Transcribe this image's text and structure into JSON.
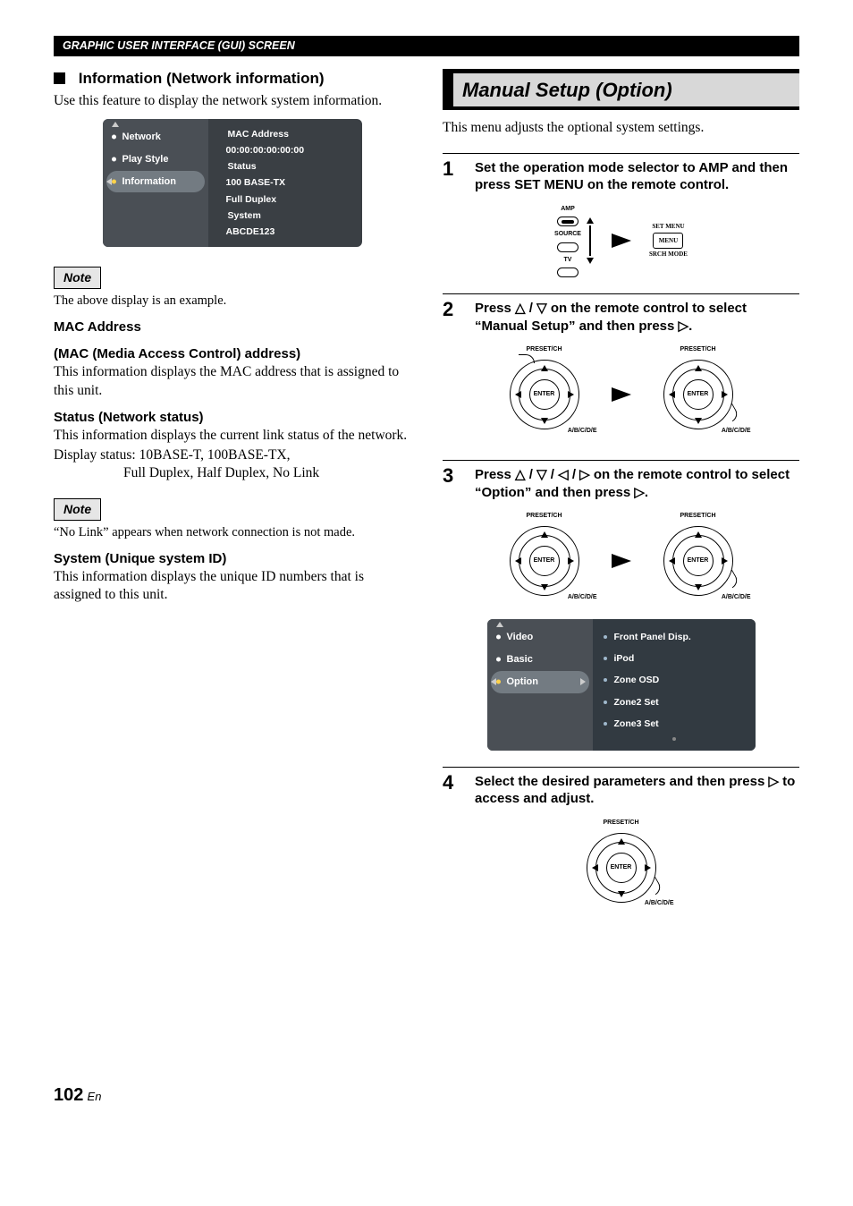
{
  "header": "GRAPHIC USER INTERFACE (GUI) SCREEN",
  "left": {
    "title": "Information (Network information)",
    "intro": "Use this feature to display the network system information.",
    "osd": {
      "items": [
        "Network",
        "Play Style",
        "Information"
      ],
      "right": {
        "mac_label": "MAC Address",
        "mac_value": "00:00:00:00:00:00",
        "status_label": "Status",
        "status_v1": "100 BASE-TX",
        "status_v2": "Full Duplex",
        "system_label": "System",
        "system_value": "ABCDE123"
      }
    },
    "note1_label": "Note",
    "note1_text": "The above display is an example.",
    "mac_head": "MAC Address",
    "mac_sub": "(MAC (Media Access Control) address)",
    "mac_body": "This information displays the MAC address that is assigned to this unit.",
    "status_head": "Status (Network status)",
    "status_body": "This information displays the current link status of the network.",
    "status_line1": "Display status: 10BASE-T, 100BASE-TX,",
    "status_line2": "Full Duplex, Half Duplex, No Link",
    "note2_label": "Note",
    "note2_text": "“No Link” appears when network connection is not made.",
    "system_head": "System (Unique system ID)",
    "system_body": "This information displays the unique ID numbers that is assigned to this unit."
  },
  "right": {
    "title": "Manual Setup (Option)",
    "intro": "This menu adjusts the optional system settings.",
    "steps": {
      "s1": "Set the operation mode selector to AMP and then press SET MENU on the remote control.",
      "s2a": "Press ",
      "s2b": " on the remote control to select “Manual Setup” and then press ",
      "s3a": "Press ",
      "s3b": " on the remote control to select “Option” and then press ",
      "s4a": "Select the desired parameters and then press ",
      "s4b": " to access and adjust."
    },
    "selector": {
      "amp": "AMP",
      "source": "SOURCE",
      "tv": "TV",
      "setmenu": "SET MENU",
      "menu": "MENU",
      "srch": "SRCH MODE"
    },
    "dpad": {
      "top": "PRESET/CH",
      "center": "ENTER",
      "br": "A/B/C/D/E"
    },
    "osd2": {
      "left": [
        "Video",
        "Basic",
        "Option"
      ],
      "right": [
        "Front Panel Disp.",
        "iPod",
        "Zone OSD",
        "Zone2 Set",
        "Zone3 Set"
      ]
    }
  },
  "footer": {
    "page": "102",
    "lang": "En"
  }
}
